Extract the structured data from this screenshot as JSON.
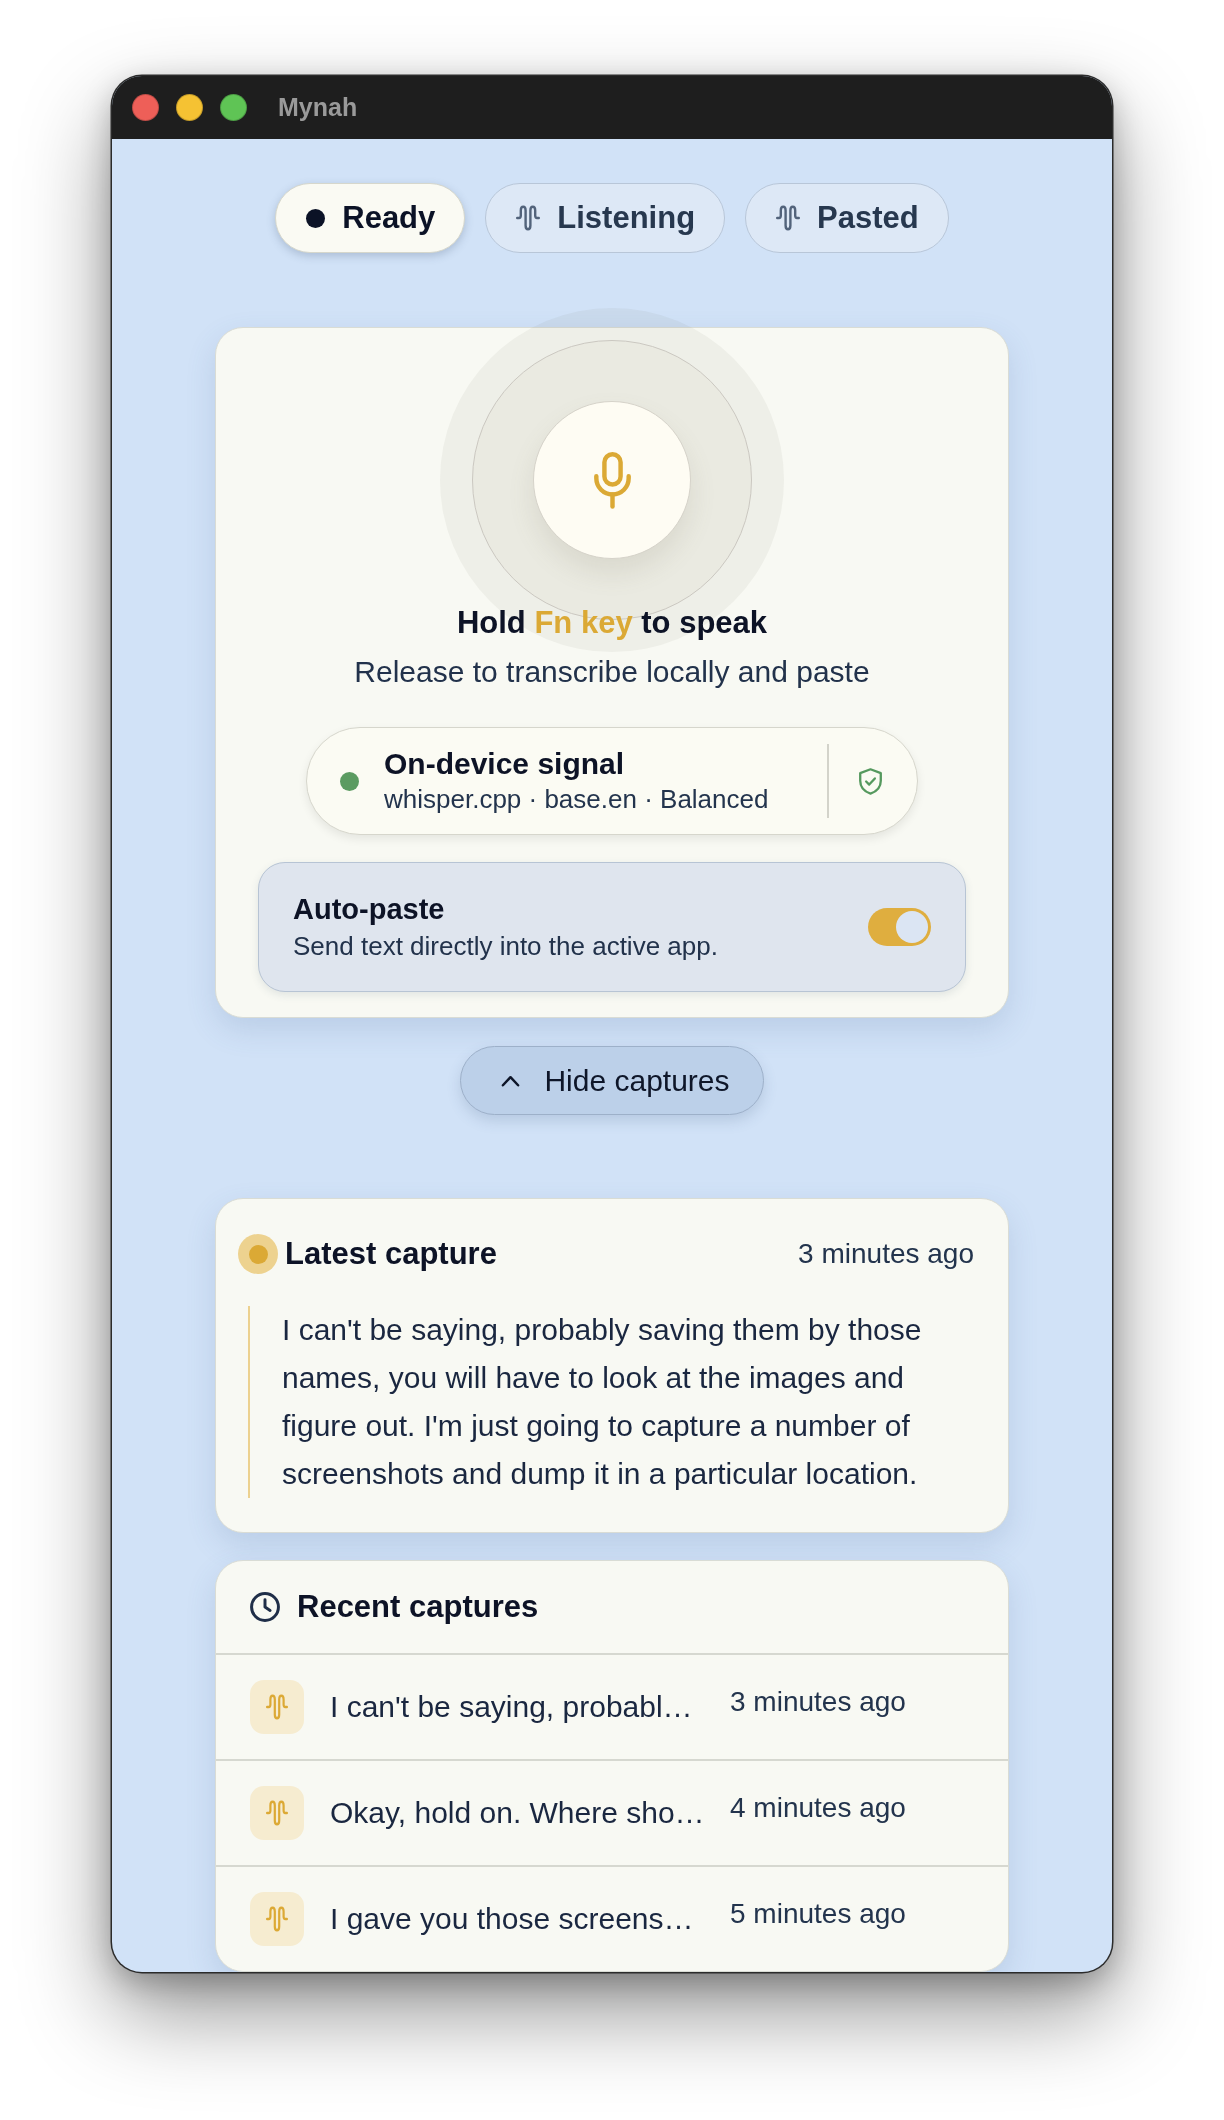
{
  "window": {
    "title": "Mynah"
  },
  "status_tabs": [
    {
      "label": "Ready",
      "selected": true,
      "kind": "dot"
    },
    {
      "label": "Listening",
      "selected": false,
      "kind": "wave"
    },
    {
      "label": "Pasted",
      "selected": false,
      "kind": "wave"
    }
  ],
  "recorder": {
    "hint": {
      "lead": "Hold",
      "key": "Fn key",
      "tail": "to speak"
    },
    "subtitle": "Release to transcribe locally and paste",
    "engine": {
      "title": "On-device signal",
      "detail": "whisper.cpp · base.en · Balanced",
      "online": true
    },
    "auto_paste": {
      "label": "Auto-paste",
      "description": "Send text directly into the active app.",
      "on": true
    }
  },
  "captures_toggle": {
    "label": "Hide captures",
    "expanded": true
  },
  "latest_capture": {
    "title": "Latest capture",
    "time": "3 minutes ago",
    "text": "I can't be saying, probably saving them by those names, you will have to look at the images and figure out. I'm just going to capture a number of screenshots and dump it in a particular location."
  },
  "recent_captures": {
    "title": "Recent captures",
    "items": [
      {
        "text": "I can't be saying, probabl…",
        "time": "3 minutes ago"
      },
      {
        "text": "Okay, hold on. Where sho…",
        "time": "4 minutes ago"
      },
      {
        "text": "I gave you those screens…",
        "time": "5 minutes ago"
      }
    ]
  }
}
